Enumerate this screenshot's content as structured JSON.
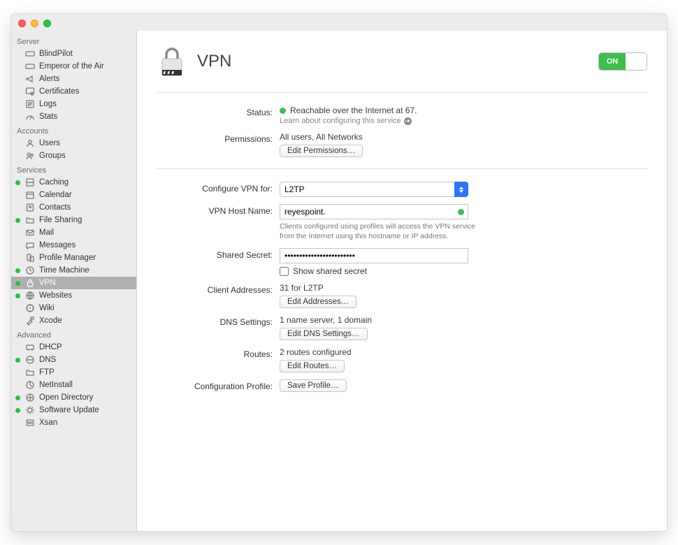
{
  "page": {
    "title": "VPN"
  },
  "toggle": {
    "on_label": "ON",
    "state": true
  },
  "sidebar": {
    "sections": {
      "server": {
        "header": "Server",
        "items": [
          "BlindPilot",
          "Emperor of the Air",
          "Alerts",
          "Certificates",
          "Logs",
          "Stats"
        ]
      },
      "accounts": {
        "header": "Accounts",
        "items": [
          "Users",
          "Groups"
        ]
      },
      "services": {
        "header": "Services",
        "items": [
          "Caching",
          "Calendar",
          "Contacts",
          "File Sharing",
          "Mail",
          "Messages",
          "Profile Manager",
          "Time Machine",
          "VPN",
          "Websites",
          "Wiki",
          "Xcode"
        ]
      },
      "advanced": {
        "header": "Advanced",
        "items": [
          "DHCP",
          "DNS",
          "FTP",
          "NetInstall",
          "Open Directory",
          "Software Update",
          "Xsan"
        ]
      }
    }
  },
  "status": {
    "label": "Status:",
    "text": "Reachable over the Internet at 67.",
    "hint": "Learn about configuring this service"
  },
  "permissions": {
    "label": "Permissions:",
    "value": "All users, All Networks",
    "button": "Edit Permissions…"
  },
  "configure": {
    "label": "Configure VPN for:",
    "selected": "L2TP"
  },
  "hostname": {
    "label": "VPN Host Name:",
    "value": "reyespoint.",
    "hint": "Clients configured using profiles will access the VPN service from the Internet using this hostname or IP address."
  },
  "secret": {
    "label": "Shared Secret:",
    "value": "••••••••••••••••••••••••",
    "checkbox_label": "Show shared secret",
    "checked": false
  },
  "client_addresses": {
    "label": "Client Addresses:",
    "value": "31 for L2TP",
    "button": "Edit Addresses…"
  },
  "dns": {
    "label": "DNS Settings:",
    "value": "1 name server, 1 domain",
    "button": "Edit DNS Settings…"
  },
  "routes": {
    "label": "Routes:",
    "value": "2 routes configured",
    "button": "Edit Routes…"
  },
  "profile": {
    "label": "Configuration Profile:",
    "button": "Save Profile…"
  }
}
